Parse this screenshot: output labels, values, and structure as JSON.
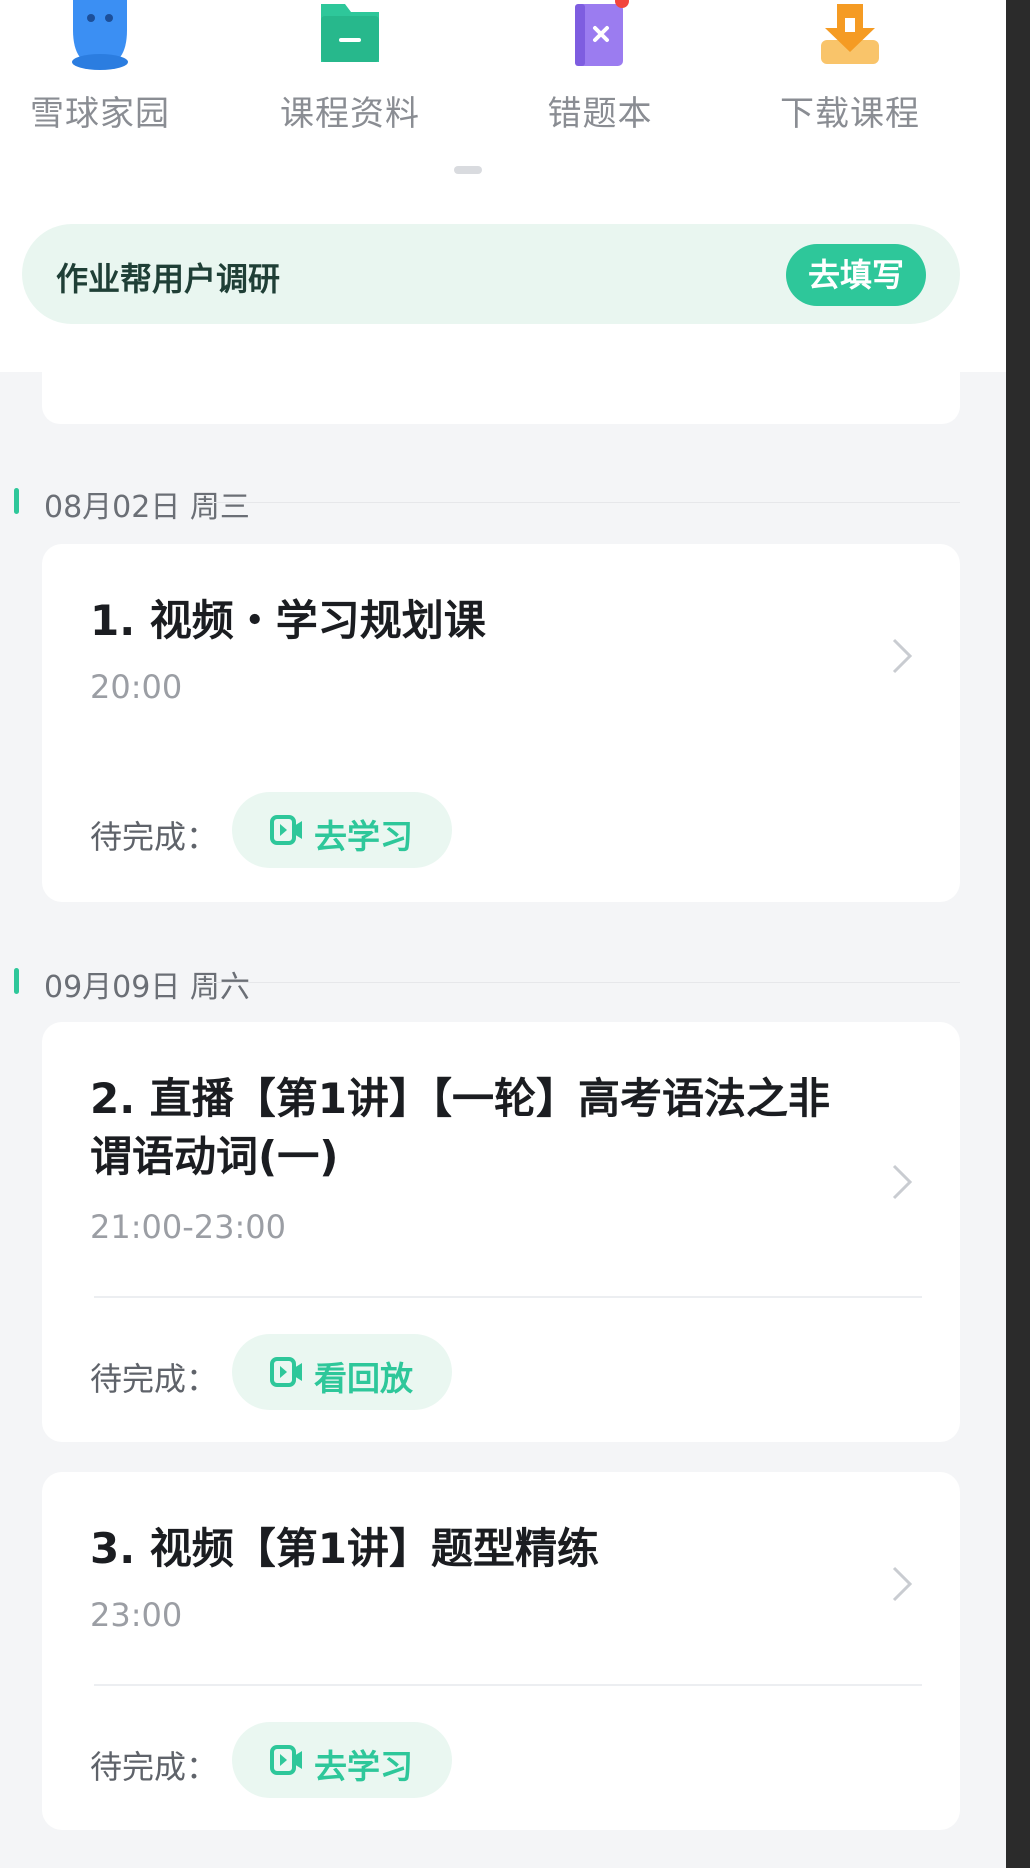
{
  "quick_nav": [
    {
      "label": "雪球家园",
      "icon": "snowball-mascot-icon"
    },
    {
      "label": "课程资料",
      "icon": "folder-icon"
    },
    {
      "label": "错题本",
      "icon": "notebook-icon",
      "badge": true
    },
    {
      "label": "下载课程",
      "icon": "download-icon"
    }
  ],
  "banner": {
    "text": "作业帮用户调研",
    "button": "去填写"
  },
  "dates": [
    {
      "label": "08月02日 周三"
    },
    {
      "label": "09月09日 周六"
    }
  ],
  "cards": [
    {
      "title": "1. 视频・学习规划课",
      "time": "20:00",
      "status": "待完成：",
      "action": "去学习"
    },
    {
      "title": "2. 直播【第1讲】【一轮】高考语法之非谓语动词(一)",
      "time": "21:00-23:00",
      "status": "待完成：",
      "action": "看回放"
    },
    {
      "title": "3. 视频【第1讲】题型精练",
      "time": "23:00",
      "status": "待完成：",
      "action": "去学习"
    }
  ],
  "colors": {
    "accent": "#2ec79a",
    "accent_light": "#eaf7f1",
    "background": "#f4f5f7"
  }
}
